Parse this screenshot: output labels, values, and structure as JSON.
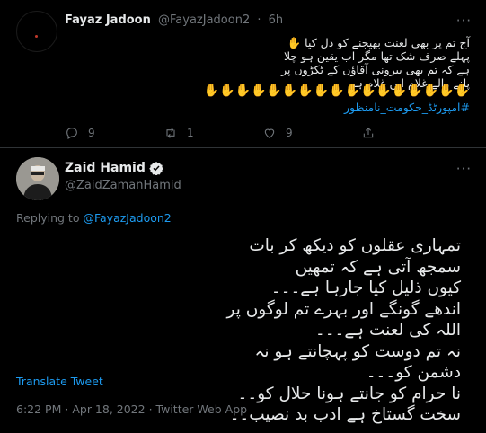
{
  "reply_tweet": {
    "name": "Fayaz Jadoon",
    "handle": "@FayazJadoon2",
    "separator": "·",
    "time": "6h",
    "lines": [
      "آج تم پر بھی لعنت بھیجنے کو دل کیا ✋",
      "پہلے صرف شک تھا مگر اب یقین ہو چلا ہے کہ تم بھی بیرونی آقاؤں کے ٹکڑوں پر",
      "پلنے والے غلام ابن غلام ہو"
    ],
    "hands": "✋✋✋✋✋✋✋✋✋✋✋✋✋✋✋✋✋",
    "hashtag": "#امپورٹڈ_حکومت_نامنظور",
    "reply_count": "9",
    "retweet_count": "1",
    "like_count": "9"
  },
  "main_tweet": {
    "name": "Zaid Hamid",
    "handle": "@ZaidZamanHamid",
    "replying_label": "Replying to",
    "replying_to": "@FayazJadoon2",
    "lines": [
      "تمہاری عقلوں کو دیکھ کر بات سمجھ آتی ہے کہ تمھیں",
      "کیوں ذلیل کیا جارہا ہے۔۔۔",
      "اندھے گونگے اور بہرے تم لوگوں پر اللہ کی لعنت ہے۔۔۔",
      "نہ تم دوست کو پہچانتے ہو نہ دشمن کو۔۔۔",
      "نا حرام کو جانتے ہونا حلال کو۔۔",
      "سخت گستاخ ہے ادب بد نصیب۔۔"
    ],
    "translate_label": "Translate Tweet",
    "time": "6:22 PM",
    "separator": "·",
    "date": "Apr 18, 2022",
    "source": "Twitter Web App"
  },
  "icons": {
    "more": "more-horizontal-icon",
    "reply": "reply-icon",
    "retweet": "retweet-icon",
    "like": "heart-icon",
    "share": "share-icon",
    "verified": "verified-badge-icon"
  },
  "colors": {
    "background": "#000000",
    "text": "#e7e9ea",
    "muted": "#71767b",
    "accent": "#1d9bf0",
    "divider": "#2f3336"
  }
}
